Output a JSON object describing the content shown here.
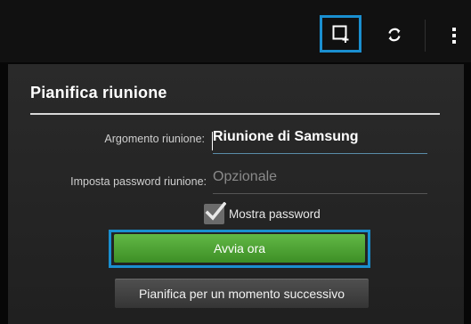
{
  "topbar": {
    "new_meeting_icon": "new-meeting-icon",
    "refresh_icon": "refresh-icon",
    "more_icon": "overflow-menu-icon",
    "highlight_color": "#1a8fd0"
  },
  "dialog": {
    "title": "Pianifica riunione",
    "topic_label": "Argomento riunione:",
    "topic_value": "Riunione di Samsung",
    "password_label": "Imposta password riunione:",
    "password_placeholder": "Opzionale",
    "show_password_label": "Mostra password",
    "show_password_checked": true,
    "start_now_label": "Avvia ora",
    "schedule_later_label": "Pianifica per un momento successivo",
    "start_button_color": "#4ea335"
  }
}
